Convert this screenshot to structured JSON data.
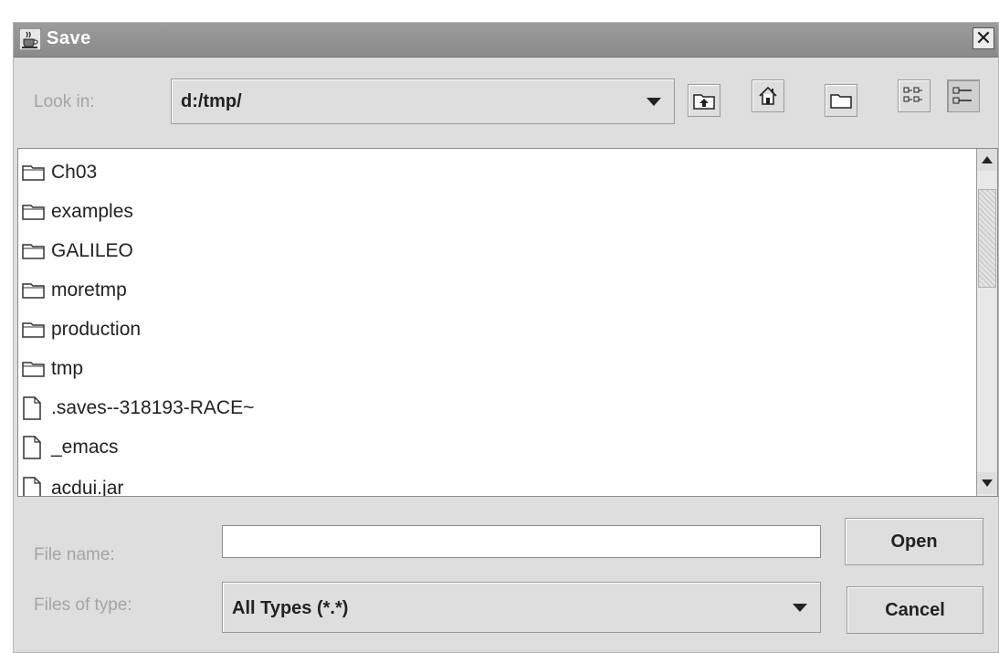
{
  "window": {
    "title": "Save",
    "close_symbol": "✕"
  },
  "toolbar": {
    "look_in_label": "Look in:",
    "look_in_value": "d:/tmp/",
    "buttons": [
      "up-folder-icon",
      "home-icon",
      "new-folder-icon",
      "list-view-icon",
      "details-view-icon"
    ]
  },
  "files": [
    {
      "name": "Ch03",
      "type": "folder"
    },
    {
      "name": "examples",
      "type": "folder"
    },
    {
      "name": "GALILEO",
      "type": "folder"
    },
    {
      "name": "moretmp",
      "type": "folder"
    },
    {
      "name": "production",
      "type": "folder"
    },
    {
      "name": "tmp",
      "type": "folder"
    },
    {
      "name": ".saves--318193-RACE~",
      "type": "file"
    },
    {
      "name": "_emacs",
      "type": "file"
    },
    {
      "name": "acdui.jar",
      "type": "file"
    }
  ],
  "form": {
    "file_name_label": "File name:",
    "file_name_value": "",
    "files_of_type_label": "Files of type:",
    "files_of_type_value": "All Types (*.*)"
  },
  "actions": {
    "open_label": "Open",
    "cancel_label": "Cancel"
  }
}
